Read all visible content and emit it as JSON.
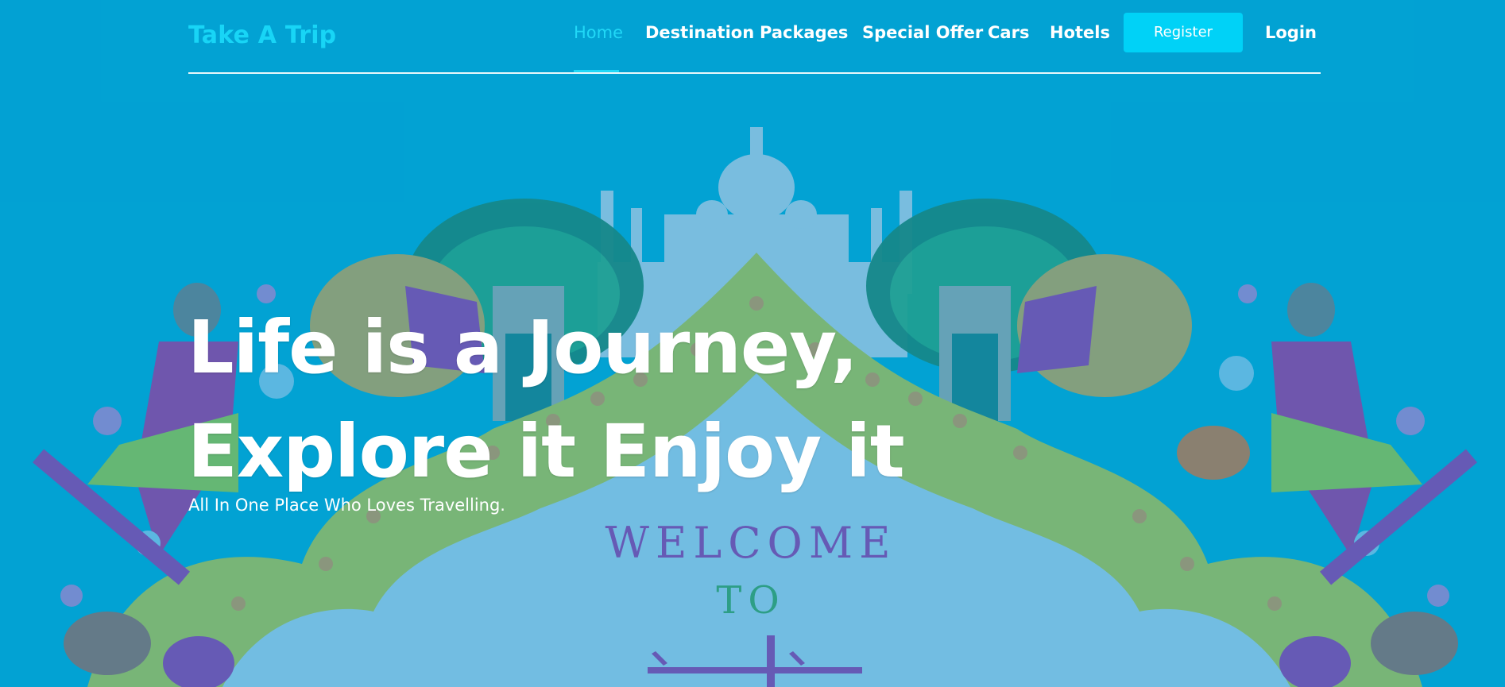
{
  "nav": {
    "brand": "Take A Trip",
    "items": [
      {
        "label": "Home",
        "active": true
      },
      {
        "label": "Destination",
        "active": false
      },
      {
        "label": "Packages",
        "active": false
      },
      {
        "label": "Special Offer",
        "active": false
      },
      {
        "label": "Cars",
        "active": false
      },
      {
        "label": "Hotels",
        "active": false
      }
    ],
    "register_label": "Register",
    "login_label": "Login"
  },
  "hero": {
    "title_line1": "Life is a Journey,",
    "title_line2": "Explore it Enjoy it",
    "subtitle": "All In One Place Who Loves Travelling.",
    "banner_welcome": "WELCOME",
    "banner_to": "TO"
  },
  "colors": {
    "background": "#03a2d3",
    "brand": "#18d5f6",
    "active_nav": "#21d8f7",
    "register_button": "#00d2f7",
    "arch_yellow": "#a7bd54",
    "welcome_purple": "#8e3fa9",
    "to_green": "#3f9d68"
  },
  "icons": {
    "illustration": "india-welcome-illustration"
  }
}
